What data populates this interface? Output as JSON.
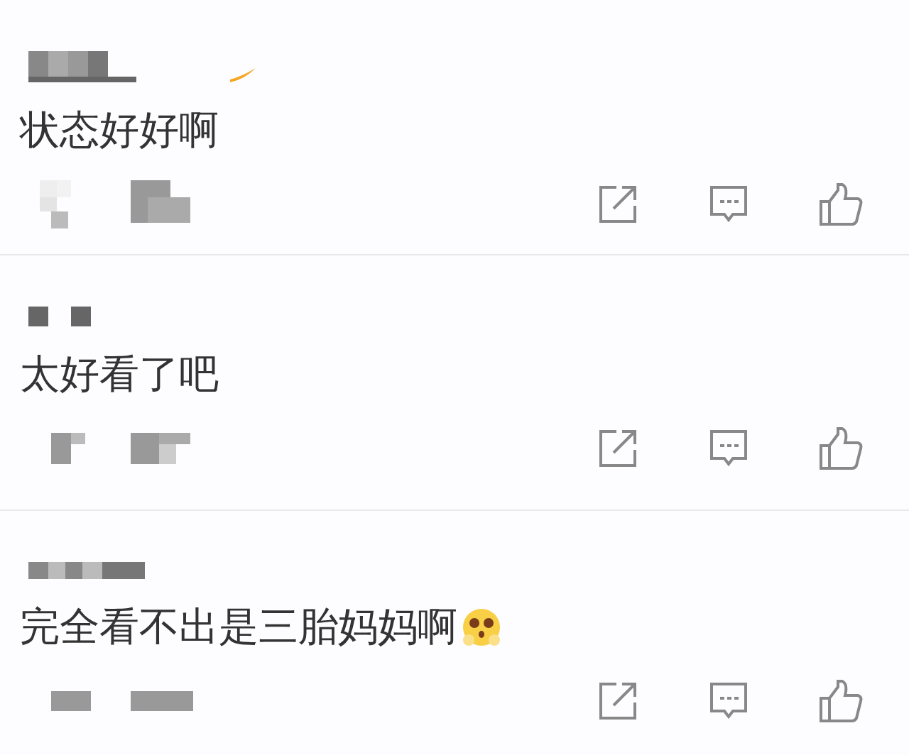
{
  "comments": [
    {
      "text": "状态好好啊",
      "has_emoji": false
    },
    {
      "text": "太好看了吧",
      "has_emoji": false
    },
    {
      "text": "完全看不出是三胎妈妈啊",
      "has_emoji": true
    }
  ]
}
